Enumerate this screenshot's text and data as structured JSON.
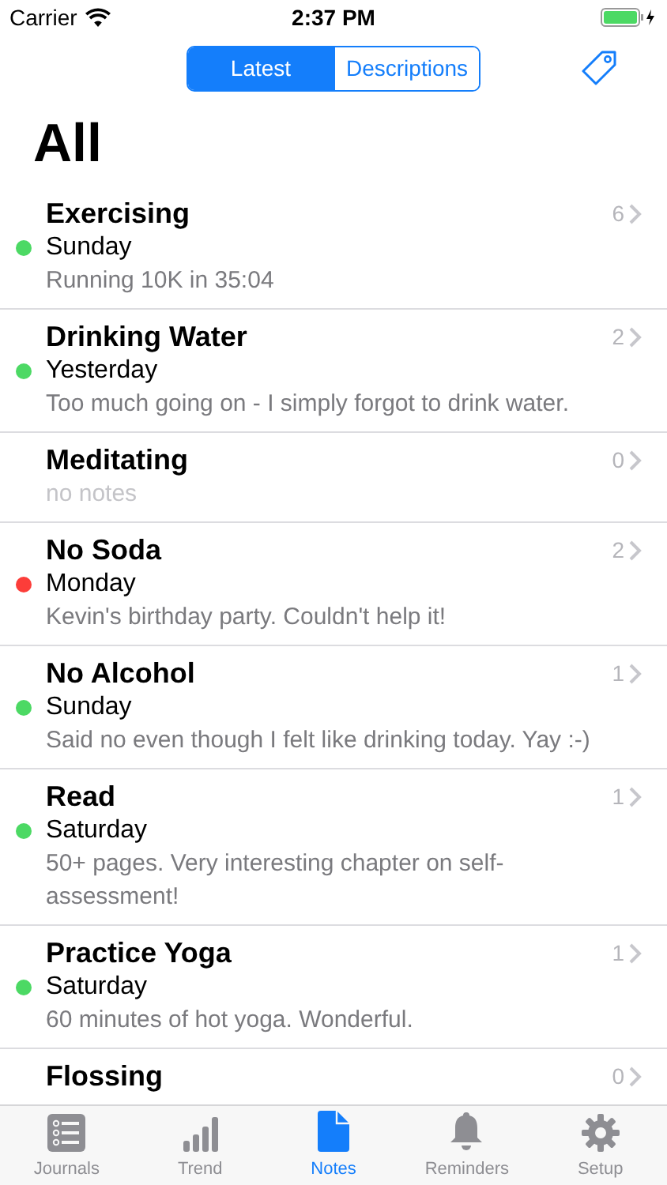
{
  "status_bar": {
    "carrier": "Carrier",
    "time": "2:37 PM"
  },
  "segments": [
    {
      "label": "Latest",
      "selected": true
    },
    {
      "label": "Descriptions",
      "selected": false
    }
  ],
  "title": "All",
  "journals": [
    {
      "name": "Exercising",
      "count": "6",
      "date": "Sunday",
      "note": "Running 10K in 35:04",
      "color": "#4cd964"
    },
    {
      "name": "Drinking Water",
      "count": "2",
      "date": "Yesterday",
      "note": "Too much going on - I simply forgot to drink water.",
      "color": "#4cd964"
    },
    {
      "name": "Meditating",
      "count": "0",
      "note": "no notes",
      "empty": true
    },
    {
      "name": "No Soda",
      "count": "2",
      "date": "Monday",
      "note": "Kevin's birthday party. Couldn't help it!",
      "color": "#fc3d39"
    },
    {
      "name": "No Alcohol",
      "count": "1",
      "date": "Sunday",
      "note": "Said no even though I felt like drinking today. Yay :-)",
      "color": "#4cd964"
    },
    {
      "name": "Read",
      "count": "1",
      "date": "Saturday",
      "note": "50+ pages. Very interesting chapter on self-assessment!",
      "color": "#4cd964"
    },
    {
      "name": "Practice Yoga",
      "count": "1",
      "date": "Saturday",
      "note": "60 minutes of hot yoga. Wonderful.",
      "color": "#4cd964"
    },
    {
      "name": "Flossing",
      "count": "0"
    }
  ],
  "tabs": [
    {
      "label": "Journals",
      "kind": "list",
      "selected": false
    },
    {
      "label": "Trend",
      "kind": "bars",
      "selected": false
    },
    {
      "label": "Notes",
      "kind": "doc",
      "selected": true
    },
    {
      "label": "Reminders",
      "kind": "bell",
      "selected": false
    },
    {
      "label": "Setup",
      "kind": "gear",
      "selected": false
    }
  ]
}
